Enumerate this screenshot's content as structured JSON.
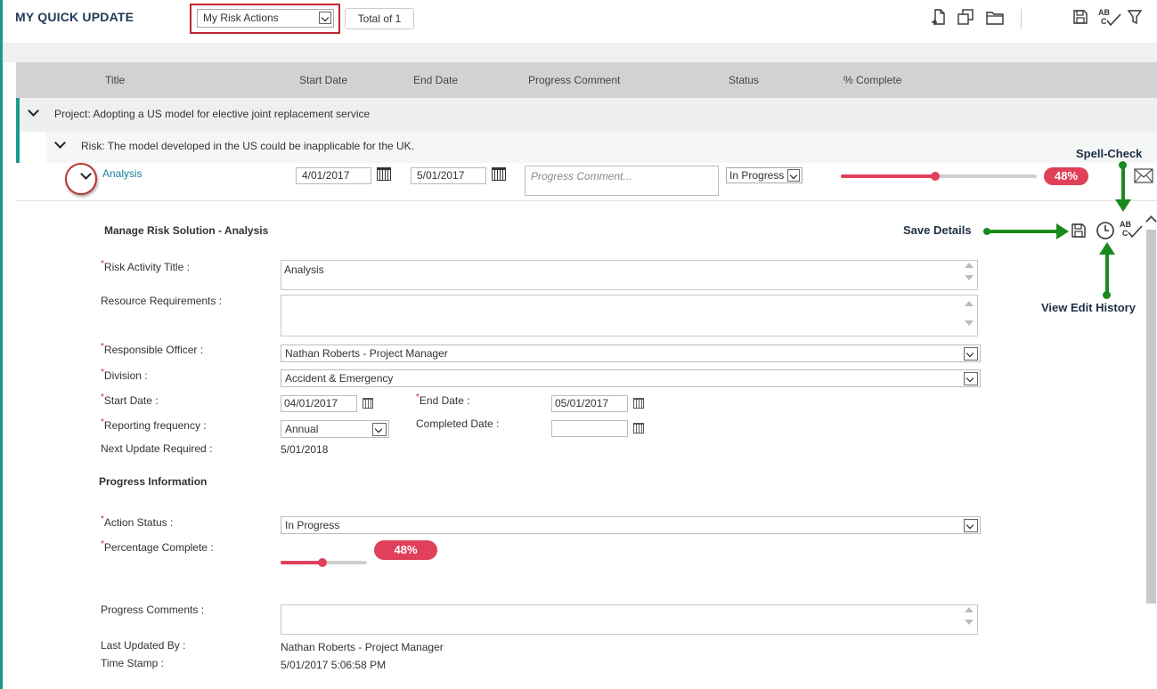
{
  "app": {
    "title": "MY QUICK UPDATE"
  },
  "toolbar": {
    "view_select": "My Risk Actions",
    "total_label": "Total of 1",
    "icons": [
      "add-document-icon",
      "copy-icon",
      "folder-icon",
      "save-icon",
      "spell-check-icon",
      "filter-icon"
    ]
  },
  "grid": {
    "headers": [
      "Title",
      "Start Date",
      "End Date",
      "Progress Comment",
      "Status",
      "% Complete"
    ],
    "project_label": "Project: Adopting a US model for elective joint replacement service",
    "risk_label": "Risk: The model developed in the US could be inapplicable for the UK.",
    "action": {
      "title": "Analysis",
      "start_date": "4/01/2017",
      "end_date": "5/01/2017",
      "comment_placeholder": "Progress Comment...",
      "status": "In Progress",
      "percent": 0.48,
      "percent_label": "48%"
    }
  },
  "detail": {
    "title": "Manage Risk Solution - Analysis",
    "fields": {
      "risk_activity_title_label": "Risk Activity Title :",
      "risk_activity_title_value": "Analysis",
      "resource_requirements_label": "Resource Requirements :",
      "responsible_officer_label": "Responsible Officer :",
      "responsible_officer_value": "Nathan Roberts - Project Manager",
      "division_label": "Division :",
      "division_value": "Accident & Emergency",
      "start_date_label": "Start Date :",
      "start_date_value": "04/01/2017",
      "end_date_label": "End Date :",
      "end_date_value": "05/01/2017",
      "reporting_frequency_label": "Reporting frequency :",
      "reporting_frequency_value": "Annual",
      "completed_date_label": "Completed Date :",
      "next_update_label": "Next Update Required :",
      "next_update_value": "5/01/2018"
    },
    "progress": {
      "section_title": "Progress Information",
      "action_status_label": "Action Status :",
      "action_status_value": "In Progress",
      "percentage_label": "Percentage Complete :",
      "percent": 0.48,
      "percent_label": "48%",
      "progress_comments_label": "Progress Comments :",
      "last_updated_by_label": "Last Updated By :",
      "last_updated_by_value": "Nathan Roberts - Project Manager",
      "timestamp_label": "Time Stamp :",
      "timestamp_value": "5/01/2017 5:06:58 PM"
    }
  },
  "annotations": {
    "save_details": "Save Details",
    "spell_check": "Spell-Check",
    "view_edit_history": "View Edit History"
  },
  "colors": {
    "accent_teal": "#1a9a8c",
    "progress_red": "#e0405a",
    "highlight_red": "#c0262c",
    "annotation_green": "#1a8a1a"
  }
}
